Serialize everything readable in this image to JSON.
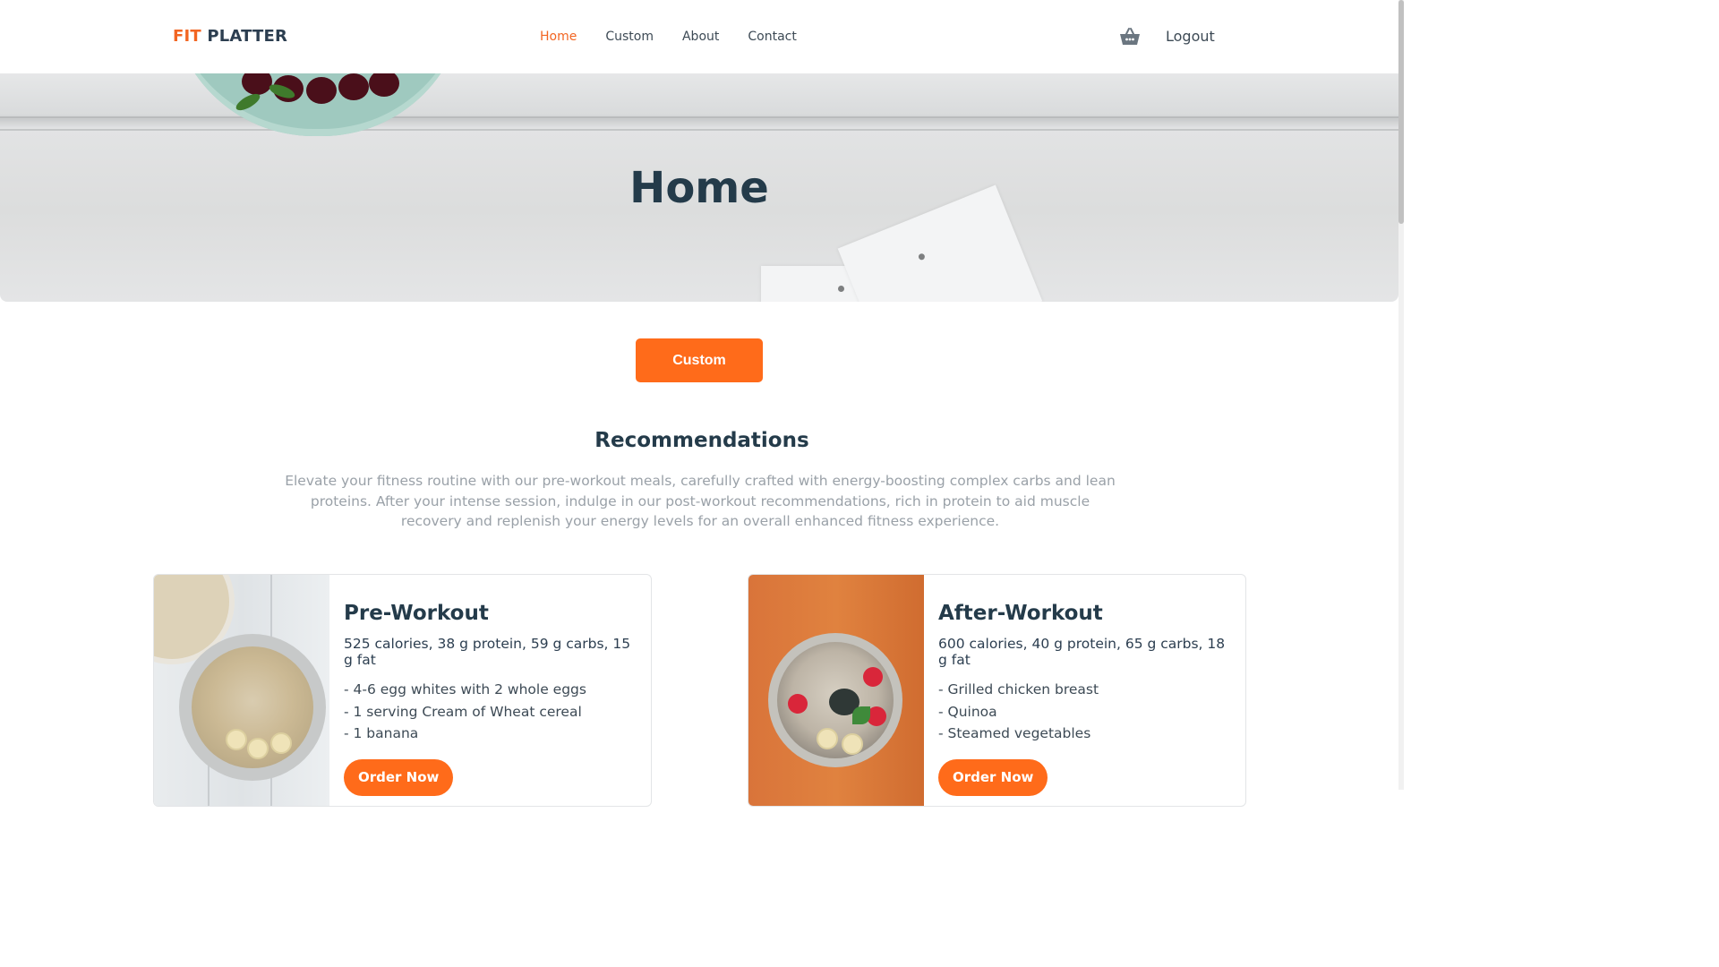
{
  "brand": {
    "fit": "FIT",
    "platter": "PLATTER"
  },
  "nav": {
    "items": [
      {
        "label": "Home",
        "active": true
      },
      {
        "label": "Custom",
        "active": false
      },
      {
        "label": "About",
        "active": false
      },
      {
        "label": "Contact",
        "active": false
      }
    ],
    "cart_icon": "shopping-basket-icon",
    "logout_label": "Logout"
  },
  "hero": {
    "title": "Home"
  },
  "custom_button_label": "Custom",
  "recommendations": {
    "title": "Recommendations",
    "text": "Elevate your fitness routine with our pre-workout meals, carefully crafted with energy-boosting complex carbs and lean proteins. After your intense session, indulge in our post-workout recommendations, rich in protein to aid muscle recovery and replenish your energy levels for an overall enhanced fitness experience."
  },
  "cards": [
    {
      "title": "Pre-Workout",
      "macros": "525 calories, 38 g protein, 59 g carbs, 15 g fat",
      "items": [
        "- 4-6 egg whites with 2 whole eggs",
        "- 1 serving Cream of Wheat cereal",
        "- 1 banana"
      ],
      "button": "Order Now"
    },
    {
      "title": "After-Workout",
      "macros": "600 calories, 40 g protein, 65 g carbs, 18 g fat",
      "items": [
        "- Grilled chicken breast",
        "- Quinoa",
        "- Steamed vegetables"
      ],
      "button": "Order Now"
    }
  ],
  "colors": {
    "accent": "#ff6b1a",
    "brand_orange": "#f26522",
    "heading": "#243b4a",
    "muted_text": "#9aa1a8"
  }
}
